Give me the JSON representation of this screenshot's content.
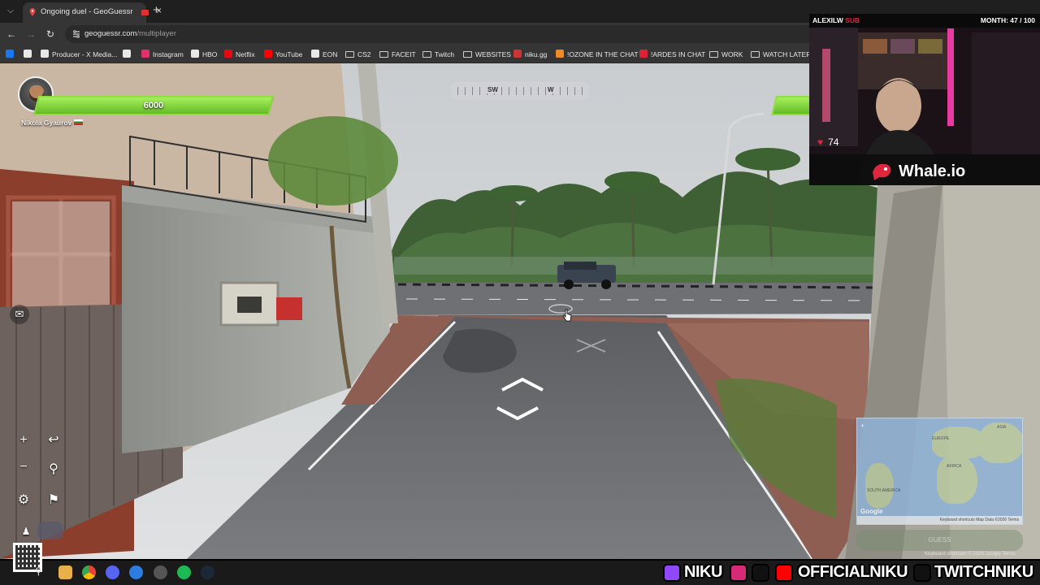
{
  "browser": {
    "tab_title": "Ongoing duel - GeoGuessr",
    "url_domain": "geoguessr.com",
    "url_path": "/multiplayer",
    "bookmarks": [
      {
        "label": "",
        "icon": "facebook-icon",
        "color": "#1877f2"
      },
      {
        "label": "",
        "icon": "x-icon",
        "color": "#e8e8e8"
      },
      {
        "label": "Producer - X Media...",
        "icon": "x-icon",
        "color": "#e8e8e8"
      },
      {
        "label": "",
        "icon": "tiktok-icon",
        "color": "#e8e8e8"
      },
      {
        "label": "Instagram",
        "icon": "instagram-icon",
        "color": "#e1306c"
      },
      {
        "label": "HBO",
        "icon": "hbo-icon",
        "color": "#e8e8e8"
      },
      {
        "label": "Netflix",
        "icon": "netflix-icon",
        "color": "#e50914"
      },
      {
        "label": "YouTube",
        "icon": "youtube-icon",
        "color": "#ff0000"
      },
      {
        "label": "EON",
        "icon": "eon-icon",
        "color": "#e8e8e8"
      },
      {
        "label": "CS2",
        "icon": "folder-icon",
        "color": ""
      },
      {
        "label": "FACEIT",
        "icon": "folder-icon",
        "color": ""
      },
      {
        "label": "Twitch",
        "icon": "folder-icon",
        "color": ""
      },
      {
        "label": "WEBSITES",
        "icon": "folder-icon",
        "color": ""
      },
      {
        "label": "niku.gg",
        "icon": "niku-icon",
        "color": "#c33"
      },
      {
        "label": "!OZONE IN THE CHAT",
        "icon": "ozone-icon",
        "color": "#f08a24"
      },
      {
        "label": "!ARDES IN CHAT",
        "icon": "ardes-icon",
        "color": "#d23"
      },
      {
        "label": "WORK",
        "icon": "folder-icon",
        "color": ""
      },
      {
        "label": "WATCH LATER",
        "icon": "folder-icon",
        "color": ""
      }
    ]
  },
  "game": {
    "player_health": "6000",
    "player_health_fraction": 1.0,
    "player_name": "Nikola Gyaurov",
    "compass_labels": [
      "SW",
      "W"
    ],
    "minimap_labels": [
      "EUROPE",
      "ASIA",
      "AFRICA",
      "SOUTH AMERICA"
    ],
    "minimap_footer": "Keyboard shortcuts   Map Data ©2026   Terms",
    "guess_label": "GUESS",
    "attribution": "Keyboard shortcuts  © 2026 Google  Terms",
    "google_logo": "Google"
  },
  "stream": {
    "top_left_name": "ALEXILW",
    "top_left_extra": "SUB",
    "top_right": "MONTH: 47 / 100",
    "heart_rate": "74",
    "sponsor": "Whale.io",
    "socials": [
      "NIKU",
      "OFFICIALNIKU",
      "TWITCHNIKU"
    ]
  },
  "colors": {
    "health_green": "#7fd63a",
    "chrome_dark": "#1f1f1f",
    "chrome_mid": "#353535",
    "accent_red": "#e0263e"
  }
}
